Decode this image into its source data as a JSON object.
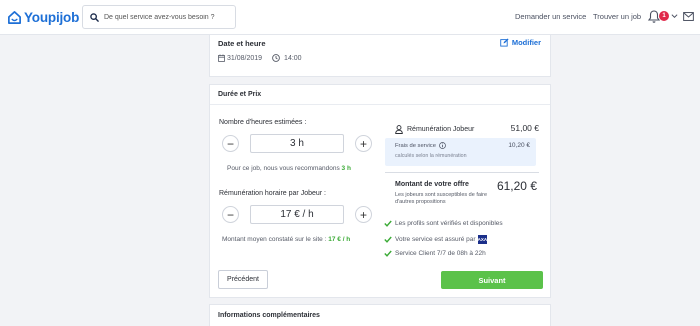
{
  "header": {
    "logo_text": "Youpijob",
    "search_placeholder": "De quel service avez-vous besoin ?",
    "nav_request": "Demander un service",
    "nav_find_job": "Trouver un job",
    "notification_count": "1",
    "brand_color": "#1d6fd6"
  },
  "date_section": {
    "title": "Date et heure",
    "edit_label": "Modifier",
    "date": "31/08/2019",
    "time": "14:00"
  },
  "duration_section": {
    "title": "Durée et Prix",
    "hours_label": "Nombre d'heures estimées :",
    "hours_value": "3 h",
    "hours_hint_prefix": "Pour ce job, nous vous recommandons",
    "hours_hint_value": "3 h",
    "rate_label": "Rémunération horaire par Jobeur :",
    "rate_value": "17 € / h",
    "rate_hint_prefix": "Montant moyen constaté sur le site :",
    "rate_hint_value": "17 € / h",
    "minus_symbol": "−",
    "plus_symbol": "+"
  },
  "summary": {
    "remuneration_label": "Rémunération Jobeur",
    "remuneration_amount": "51,00 €",
    "fees_label": "Frais de service",
    "fees_sub": "calculés selon la rémunération",
    "fees_amount": "10,20 €",
    "offer_label": "Montant de votre offre",
    "offer_amount": "61,20 €",
    "offer_sub": "Les jobeurs sont susceptibles de faire d'autres propositions",
    "checks": [
      "Les profils sont vérifiés et disponibles",
      "Votre service est assuré par",
      "Service Client 7/7 de 08h à 22h"
    ],
    "insurer_logo": "AXA"
  },
  "actions": {
    "previous": "Précédent",
    "next": "Suivant",
    "next_color": "#5bc24a"
  },
  "more_section": {
    "title": "Informations complémentaires"
  }
}
